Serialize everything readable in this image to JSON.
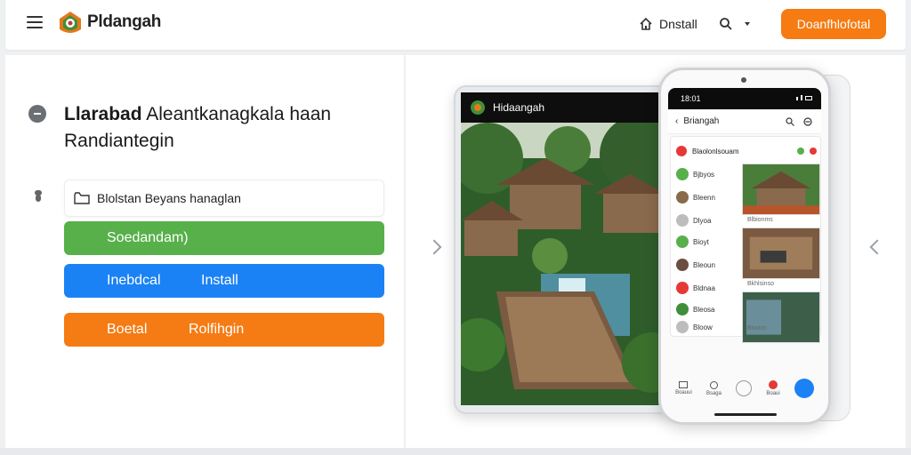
{
  "header": {
    "brand": "Pldangah",
    "install_label": "Dnstall",
    "cta_label": "Doanfhlofotal",
    "icons": [
      "menu-icon",
      "home-icon",
      "search-icon",
      "chevron-down-icon"
    ]
  },
  "hero": {
    "headline_bold": "Llarabad",
    "headline_rest": "Aleantkanagkala haan",
    "headline_line2": "Randiantegin"
  },
  "form": {
    "input_label": "Blolstan Beyans hanaglan",
    "green_button": "Soedandam)",
    "blue_button_left": "Inebdcal",
    "blue_button_right": "Install",
    "orange_button_left": "Boetal",
    "orange_button_right": "Rolfihgin"
  },
  "tablet": {
    "title": "Hidaangah"
  },
  "phone": {
    "status_time": "18:01",
    "appbar_title": "Briangah",
    "list_header": "Blaolonlsouam",
    "chips": [
      "Bjbyos",
      "Bleenn",
      "Dlyoa",
      "Bioyt",
      "Bleoun",
      "Bldnaa",
      "Bleosa",
      "Bloow"
    ],
    "thumb_labels": [
      "Blbionms",
      "Bkhlsinso",
      "Biooun"
    ],
    "nav": [
      "Boauui",
      "Bsaga",
      "",
      "Boaui",
      ""
    ]
  },
  "colors": {
    "green": "#57b04a",
    "blue": "#1b82f5",
    "orange": "#f57b14",
    "cta": "#f57b12"
  }
}
